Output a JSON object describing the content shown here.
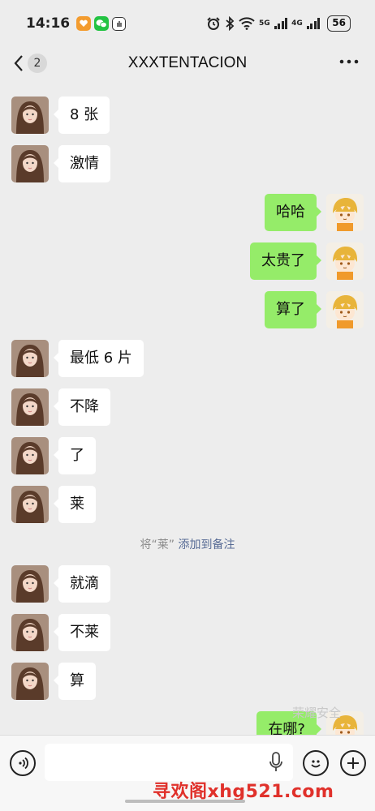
{
  "status": {
    "time": "14:16",
    "network1": "5G",
    "network2": "4G",
    "battery": "56"
  },
  "header": {
    "back_count": "2",
    "title": "XXXTENTACION"
  },
  "messages": [
    {
      "side": "left",
      "text": "8 张"
    },
    {
      "side": "left",
      "text": "激情"
    },
    {
      "side": "right",
      "text": "哈哈"
    },
    {
      "side": "right",
      "text": "太贵了"
    },
    {
      "side": "right",
      "text": "算了"
    },
    {
      "side": "left",
      "text": "最低 6 片"
    },
    {
      "side": "left",
      "text": "不降"
    },
    {
      "side": "left",
      "text": "了"
    },
    {
      "side": "left",
      "text": "莱"
    },
    {
      "side": "left",
      "text": "就滴"
    },
    {
      "side": "left",
      "text": "不莱"
    },
    {
      "side": "left",
      "text": "算"
    },
    {
      "side": "right",
      "text": "在哪?"
    }
  ],
  "system_note": {
    "prefix": "将“莱”",
    "link": "添加到备注"
  },
  "watermark": "荣耀安全",
  "site_watermark": "寻欢阁xhg521.com",
  "colors": {
    "background": "#ededed",
    "sent_bubble": "#95ec69",
    "received_bubble": "#ffffff",
    "link": "#576b95"
  }
}
